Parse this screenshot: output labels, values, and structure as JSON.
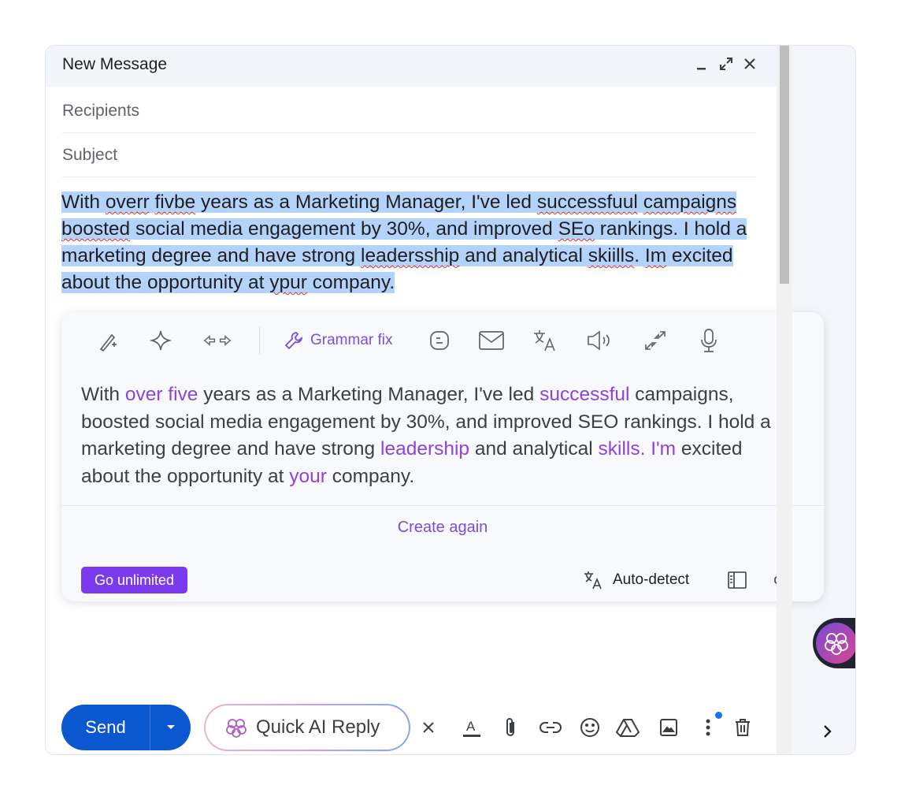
{
  "compose": {
    "title": "New Message",
    "recipients_placeholder": "Recipients",
    "subject_placeholder": "Subject",
    "body_segments": [
      {
        "text": "With ",
        "misspelled": false
      },
      {
        "text": "overr",
        "misspelled": true
      },
      {
        "text": " ",
        "misspelled": false
      },
      {
        "text": "fivbe",
        "misspelled": true
      },
      {
        "text": " years as a Marketing Manager, I've led ",
        "misspelled": false
      },
      {
        "text": "successfuul",
        "misspelled": true
      },
      {
        "text": "  ",
        "misspelled": false
      },
      {
        "text": "campaigns",
        "misspelled": true
      },
      {
        "text": "  ",
        "misspelled": false
      },
      {
        "text": "boosted",
        "misspelled": true
      },
      {
        "text": " social media engagement by 30%, and improved ",
        "misspelled": false
      },
      {
        "text": "SEo",
        "misspelled": true
      },
      {
        "text": "  rankings. I hold a marketing degree and have strong ",
        "misspelled": false
      },
      {
        "text": "leadersship",
        "misspelled": true
      },
      {
        "text": " and analytical ",
        "misspelled": false
      },
      {
        "text": "skiills",
        "misspelled": true
      },
      {
        "text": ". ",
        "misspelled": false
      },
      {
        "text": "Im",
        "misspelled": true
      },
      {
        "text": " excited about the opportunity at ",
        "misspelled": false
      },
      {
        "text": "ypur",
        "misspelled": true
      },
      {
        "text": " company.",
        "misspelled": false
      }
    ]
  },
  "ai_panel": {
    "toolbar": {
      "grammar_label": "Grammar fix",
      "icons": [
        "magic-wand-icon",
        "sparkle-icon",
        "arrows-left-right-icon",
        "wrench-icon",
        "blog-icon",
        "mail-icon",
        "translate-icon",
        "speaker-icon",
        "arrows-shrink-icon",
        "microphone-icon"
      ]
    },
    "output_segments": [
      {
        "text": "With ",
        "changed": false
      },
      {
        "text": "over five",
        "changed": true
      },
      {
        "text": " years as a Marketing Manager, I've led ",
        "changed": false
      },
      {
        "text": "successful",
        "changed": true
      },
      {
        "text": " campaigns, boosted social media engagement by 30%, and improved SEO rankings. I hold a marketing degree and have strong ",
        "changed": false
      },
      {
        "text": "leadership",
        "changed": true
      },
      {
        "text": " and analytical ",
        "changed": false
      },
      {
        "text": "skills. I'm",
        "changed": true
      },
      {
        "text": " excited about the opportunity at ",
        "changed": false
      },
      {
        "text": "your",
        "changed": true
      },
      {
        "text": " company.",
        "changed": false
      }
    ],
    "create_again_label": "Create again",
    "go_unlimited_label": "Go unlimited",
    "auto_detect_label": "Auto-detect"
  },
  "bottom_bar": {
    "send_label": "Send",
    "quick_ai_reply_label": "Quick AI Reply"
  },
  "colors": {
    "send_blue": "#0b57d0",
    "accent_purple": "#7c3aed",
    "selection": "#b3d3fb",
    "changed_text": "#8e44d9"
  }
}
